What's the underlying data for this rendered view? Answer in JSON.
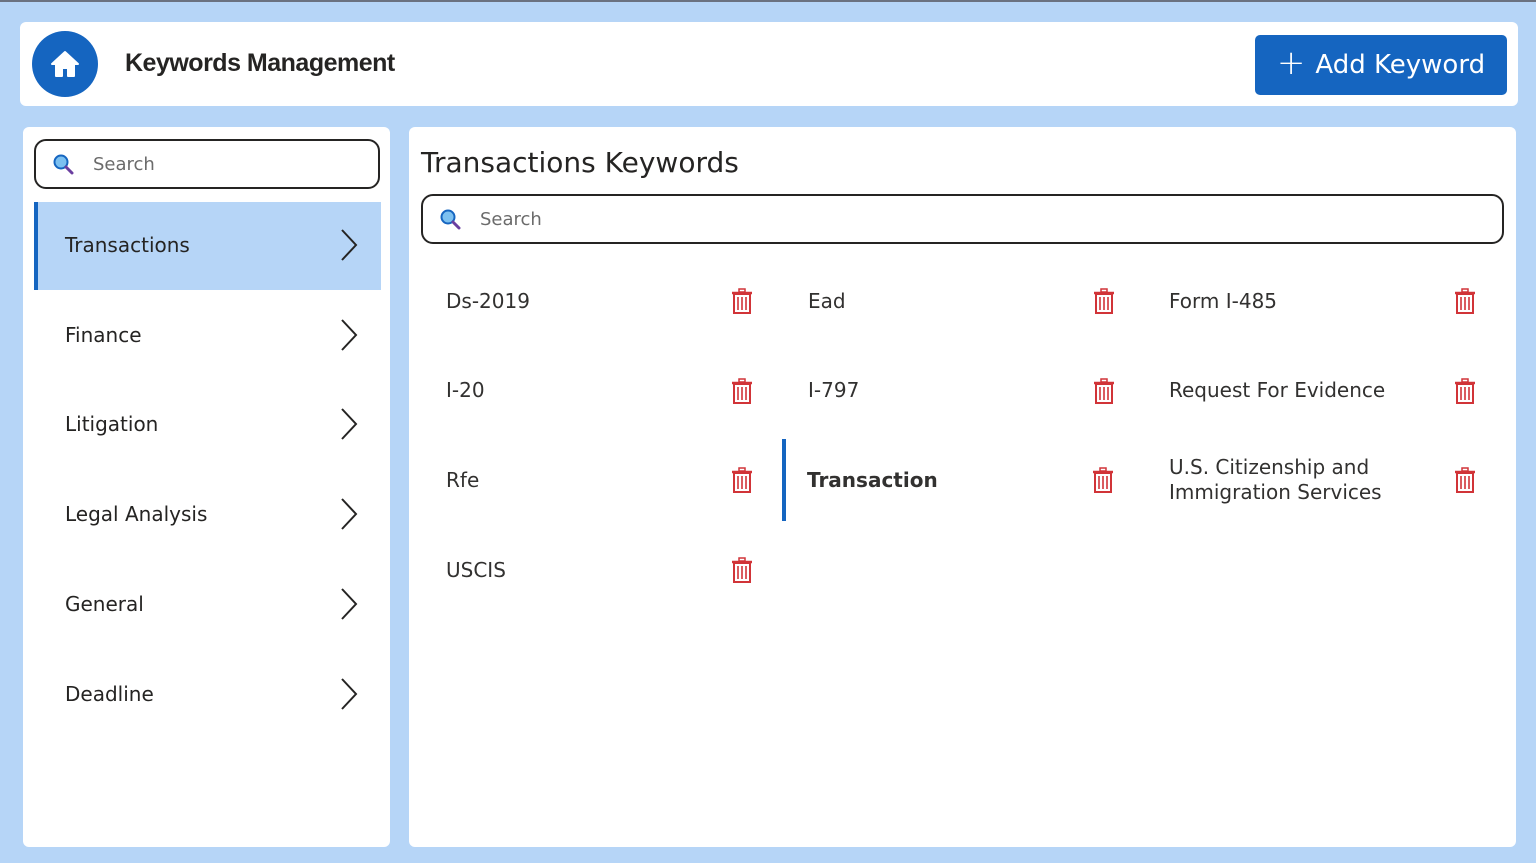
{
  "header": {
    "title": "Keywords Management",
    "add_button_label": "Add Keyword",
    "home_icon": "home-icon"
  },
  "sidebar": {
    "search_placeholder": "Search",
    "items": [
      {
        "label": "Transactions",
        "active": true
      },
      {
        "label": "Finance",
        "active": false
      },
      {
        "label": "Litigation",
        "active": false
      },
      {
        "label": "Legal Analysis",
        "active": false
      },
      {
        "label": "General",
        "active": false
      },
      {
        "label": "Deadline",
        "active": false
      }
    ]
  },
  "main": {
    "title": "Transactions Keywords",
    "search_placeholder": "Search",
    "keywords": [
      {
        "label": "Ds-2019",
        "selected": false
      },
      {
        "label": "Ead",
        "selected": false
      },
      {
        "label": "Form I-485",
        "selected": false
      },
      {
        "label": "I-20",
        "selected": false
      },
      {
        "label": "I-797",
        "selected": false
      },
      {
        "label": "Request For Evidence",
        "selected": false
      },
      {
        "label": "Rfe",
        "selected": false
      },
      {
        "label": "Transaction",
        "selected": true
      },
      {
        "label": "U.S. Citizenship and Immigration Services",
        "selected": false
      },
      {
        "label": "USCIS",
        "selected": false
      }
    ]
  },
  "colors": {
    "accent": "#1565c0",
    "background": "#b6d5f7",
    "delete": "#d13438"
  }
}
